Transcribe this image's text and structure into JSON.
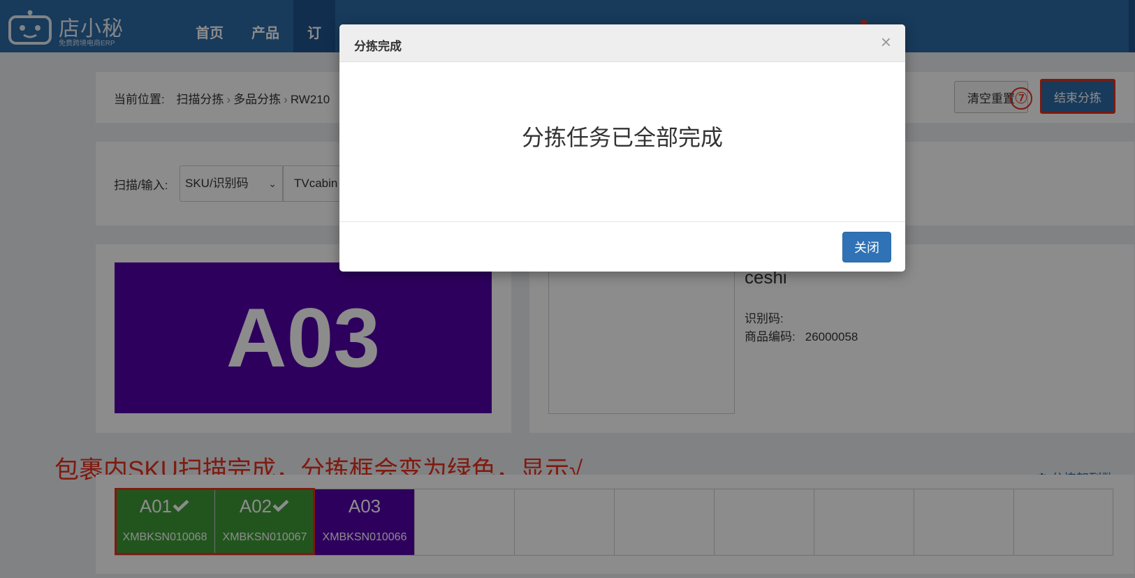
{
  "header": {
    "logo_name": "店小秘",
    "logo_sub": "免费跨境电商ERP",
    "nav": [
      {
        "label": "首页"
      },
      {
        "label": "产品"
      },
      {
        "label": "订"
      }
    ]
  },
  "breadcrumb": {
    "label": "当前位置:",
    "items": [
      "扫描分拣",
      "多品分拣",
      "RW210"
    ]
  },
  "actions": {
    "clear_label": "清空重置",
    "step_badge": "⑦",
    "end_label": "结束分拣"
  },
  "scan": {
    "label": "扫描/输入:",
    "type_selected": "SKU/识别码",
    "input_value": "TVcabin"
  },
  "current_slot": {
    "code": "A03",
    "color": "#5400ab"
  },
  "product": {
    "name": "ceshi",
    "id_code_label": "识别码:",
    "id_code_value": "",
    "goods_code_label": "商品编码:",
    "goods_code_value": "26000058"
  },
  "annotation": "包裹内SKU扫描完成，分拣框会变为绿色，显示√",
  "shelf": {
    "count_label": "分拣架列数",
    "cells": [
      {
        "code": "A01",
        "sku": "XMBKSN010068",
        "state": "done"
      },
      {
        "code": "A02",
        "sku": "XMBKSN010067",
        "state": "done"
      },
      {
        "code": "A03",
        "sku": "XMBKSN010066",
        "state": "current"
      },
      {
        "code": "",
        "sku": "",
        "state": "empty"
      },
      {
        "code": "",
        "sku": "",
        "state": "empty"
      },
      {
        "code": "",
        "sku": "",
        "state": "empty"
      },
      {
        "code": "",
        "sku": "",
        "state": "empty"
      },
      {
        "code": "",
        "sku": "",
        "state": "empty"
      },
      {
        "code": "",
        "sku": "",
        "state": "empty"
      },
      {
        "code": "",
        "sku": "",
        "state": "empty"
      }
    ]
  },
  "modal": {
    "title": "分拣完成",
    "close_glyph": "×",
    "message": "分拣任务已全部完成",
    "close_button": "关闭"
  },
  "colors": {
    "header": "#2c6aa7",
    "done": "#3e9b38",
    "current": "#5400ab",
    "annotation": "#e8301d"
  }
}
